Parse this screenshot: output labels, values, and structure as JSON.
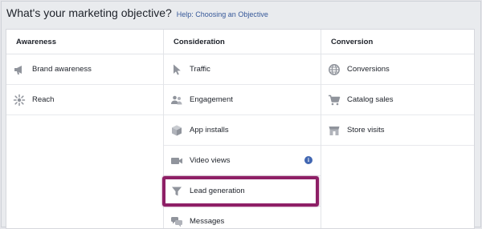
{
  "header": {
    "title": "What's your marketing objective?",
    "help_link": "Help: Choosing an Objective"
  },
  "columns": [
    {
      "title": "Awareness",
      "items": [
        {
          "label": "Brand awareness",
          "icon": "megaphone-icon"
        },
        {
          "label": "Reach",
          "icon": "reach-icon"
        }
      ]
    },
    {
      "title": "Consideration",
      "items": [
        {
          "label": "Traffic",
          "icon": "cursor-icon"
        },
        {
          "label": "Engagement",
          "icon": "people-icon"
        },
        {
          "label": "App installs",
          "icon": "box-icon"
        },
        {
          "label": "Video views",
          "icon": "video-camera-icon",
          "info": "i"
        },
        {
          "label": "Lead generation",
          "icon": "funnel-icon"
        },
        {
          "label": "Messages",
          "icon": "chat-bubbles-icon"
        }
      ]
    },
    {
      "title": "Conversion",
      "items": [
        {
          "label": "Conversions",
          "icon": "globe-icon"
        },
        {
          "label": "Catalog sales",
          "icon": "shopping-cart-icon"
        },
        {
          "label": "Store visits",
          "icon": "store-icon"
        }
      ]
    }
  ],
  "colors": {
    "highlight": "#8e1f66",
    "icon": "#90949c",
    "link": "#365899"
  }
}
